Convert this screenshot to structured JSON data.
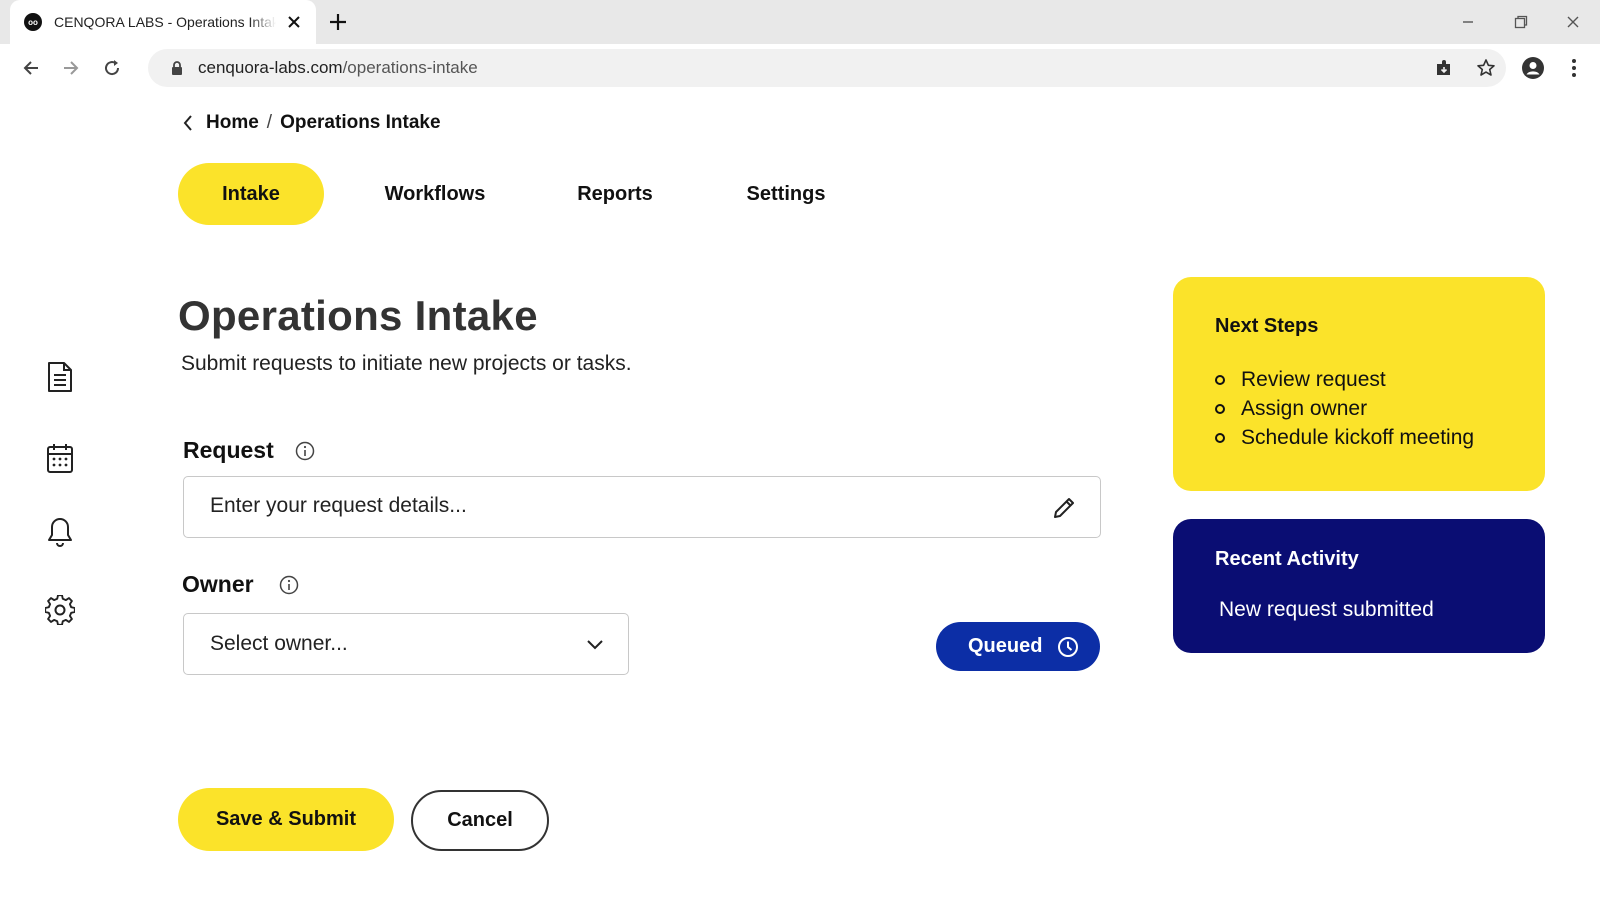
{
  "browser": {
    "tab_title": "CENQORA LABS - Operations Intake",
    "favicon_text": "oo",
    "url_domain": "cenquora-labs.com",
    "url_path": "/operations-intake"
  },
  "breadcrumb": {
    "home": "Home",
    "separator": "/",
    "current": "Operations Intake"
  },
  "nav_tabs": [
    {
      "label": "Intake",
      "active": true
    },
    {
      "label": "Workflows",
      "active": false
    },
    {
      "label": "Reports",
      "active": false
    },
    {
      "label": "Settings",
      "active": false
    }
  ],
  "page": {
    "title": "Operations Intake",
    "subtitle": "Submit requests to initiate new projects or tasks."
  },
  "form": {
    "request_label": "Request",
    "request_placeholder": "Enter your request details...",
    "owner_label": "Owner",
    "owner_value": "Select owner...",
    "status": "Queued"
  },
  "next_steps": {
    "title": "Next Steps",
    "items": [
      "Review request",
      "Assign owner",
      "Schedule kickoff meeting"
    ]
  },
  "recent_activity": {
    "title": "Recent Activity",
    "item": "New request submitted"
  },
  "actions": {
    "primary": "Save & Submit",
    "secondary": "Cancel"
  },
  "sidebar_icons": [
    "document-icon",
    "calendar-icon",
    "bell-icon",
    "gear-icon"
  ],
  "colors": {
    "accent_yellow": "#fbe32a",
    "status_blue": "#0c2ea6",
    "card_navy": "#0a0d73"
  }
}
